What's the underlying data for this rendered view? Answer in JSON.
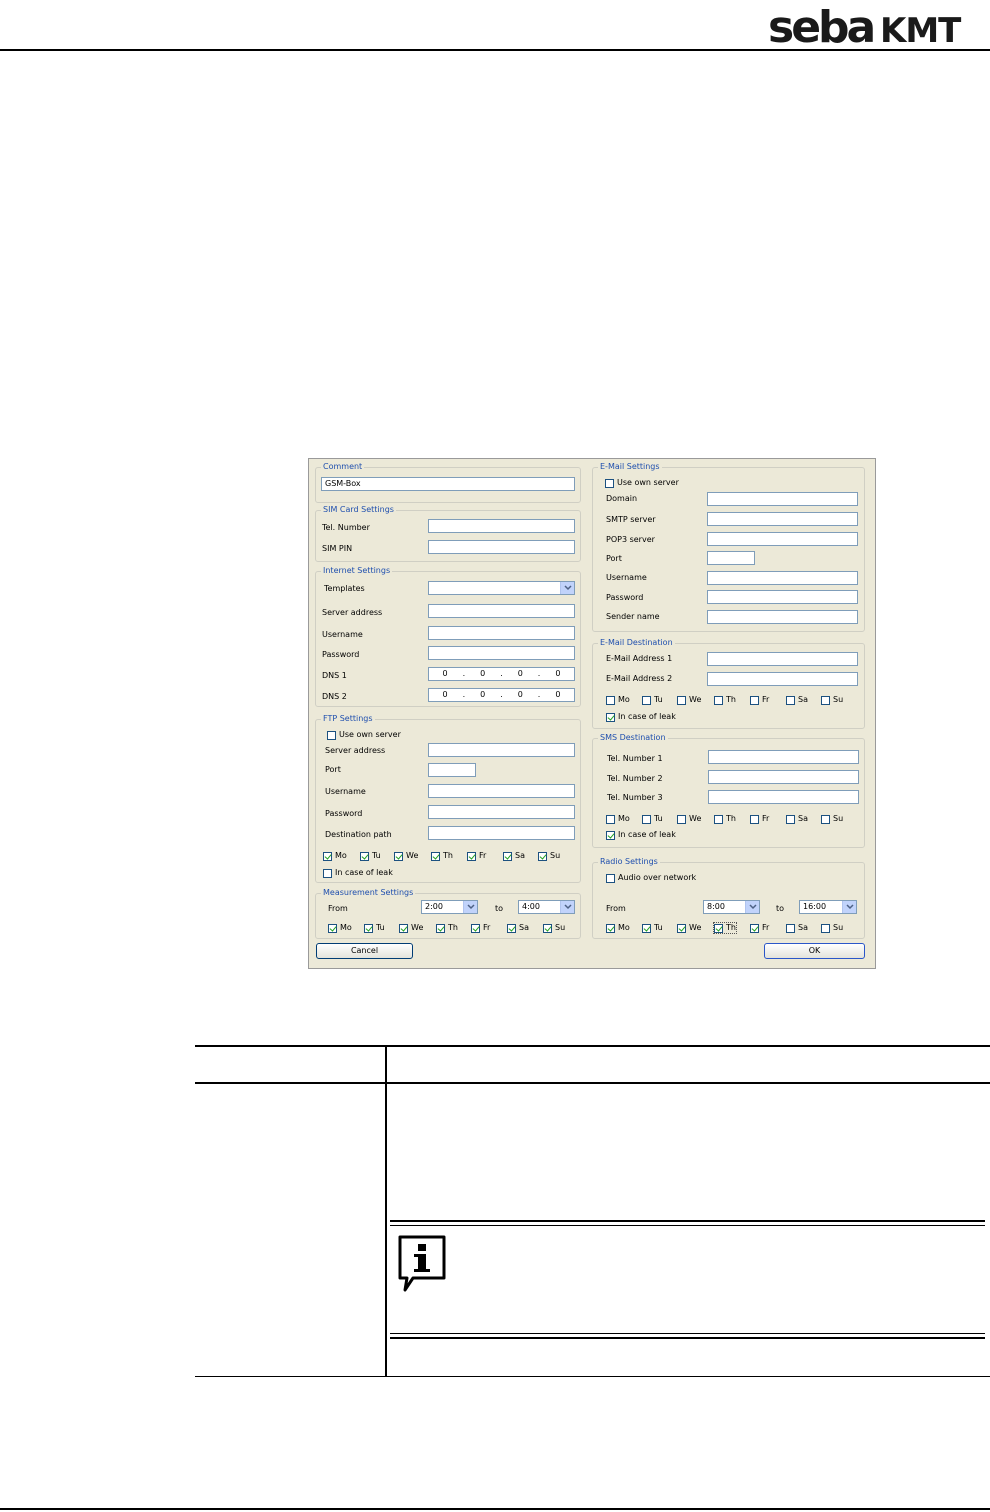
{
  "brand": {
    "logo_text": "sebaKMT"
  },
  "dialog": {
    "comment": {
      "title": "Comment",
      "value": "GSM-Box"
    },
    "sim": {
      "title": "SIM Card Settings",
      "tel_label": "Tel. Number",
      "pin_label": "SIM PIN"
    },
    "internet": {
      "title": "Internet Settings",
      "templates_label": "Templates",
      "server_label": "Server address",
      "username_label": "Username",
      "password_label": "Password",
      "dns1_label": "DNS 1",
      "dns2_label": "DNS 2",
      "dns1": [
        "0",
        ".",
        "0",
        ".",
        "0",
        ".",
        "0"
      ],
      "dns2": [
        "0",
        ".",
        "0",
        ".",
        "0",
        ".",
        "0"
      ]
    },
    "ftp": {
      "title": "FTP Settings",
      "own_server": "Use own server",
      "server_label": "Server address",
      "port_label": "Port",
      "username_label": "Username",
      "password_label": "Password",
      "dest_label": "Destination path",
      "leak": "In case of leak"
    },
    "measurement": {
      "title": "Measurement Settings",
      "from_label": "From",
      "from_value": "2:00",
      "to_label": "to",
      "to_value": "4:00"
    },
    "email_settings": {
      "title": "E-Mail Settings",
      "own_server": "Use own server",
      "domain_label": "Domain",
      "smtp_label": "SMTP server",
      "pop3_label": "POP3 server",
      "port_label": "Port",
      "username_label": "Username",
      "password_label": "Password",
      "sender_label": "Sender name"
    },
    "email_dest": {
      "title": "E-Mail Destination",
      "addr1_label": "E-Mail Address 1",
      "addr2_label": "E-Mail Address 2",
      "leak": "In case of leak"
    },
    "sms_dest": {
      "title": "SMS Destination",
      "tel1_label": "Tel. Number 1",
      "tel2_label": "Tel. Number 2",
      "tel3_label": "Tel. Number 3",
      "leak": "In case of leak"
    },
    "radio": {
      "title": "Radio Settings",
      "audio": "Audio over network",
      "from_label": "From",
      "from_value": "8:00",
      "to_label": "to",
      "to_value": "16:00"
    },
    "days": [
      "Mo",
      "Tu",
      "We",
      "Th",
      "Fr",
      "Sa",
      "Su"
    ],
    "cancel": "Cancel",
    "ok": "OK"
  }
}
